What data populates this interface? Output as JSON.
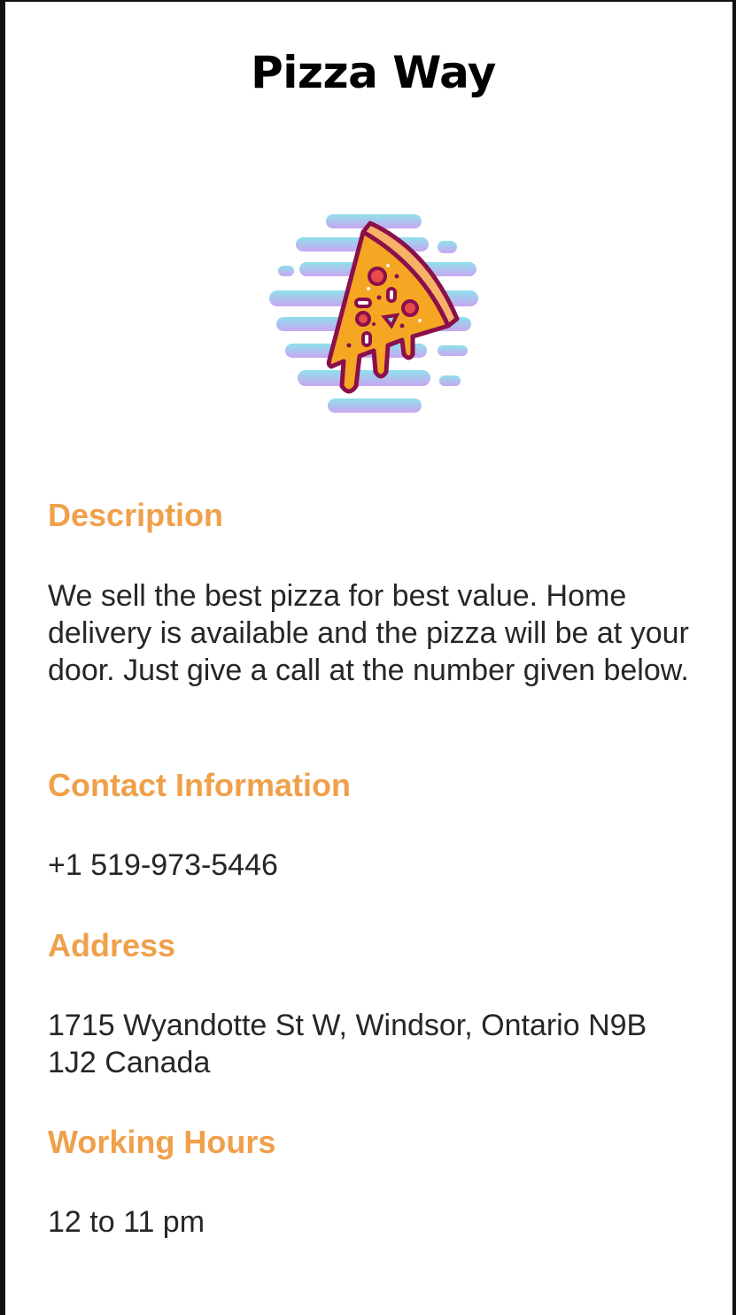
{
  "app": {
    "title": "Pizza Way"
  },
  "logo": {
    "icon": "pizza-slice-icon",
    "colors": {
      "cloud_top": "#8fe0ec",
      "cloud_bottom": "#c9a6f0",
      "crust": "#f7b267",
      "cheese": "#f5a623",
      "outline": "#8a0f4b",
      "pepperoni": "#e84a4a"
    }
  },
  "sections": {
    "description": {
      "heading": "Description",
      "text": "We sell the best pizza for best value. Home delivery is available and the pizza will be at your door. Just give a call at the number given below."
    },
    "contact": {
      "heading": "Contact Information",
      "text": "+1 519-973-5446"
    },
    "address": {
      "heading": "Address",
      "text": "1715 Wyandotte St W, Windsor, Ontario N9B 1J2 Canada"
    },
    "hours": {
      "heading": "Working Hours",
      "text": "12 to 11 pm"
    }
  },
  "theme": {
    "accent": "#f0a04b",
    "text": "#262626",
    "background": "#ffffff"
  }
}
